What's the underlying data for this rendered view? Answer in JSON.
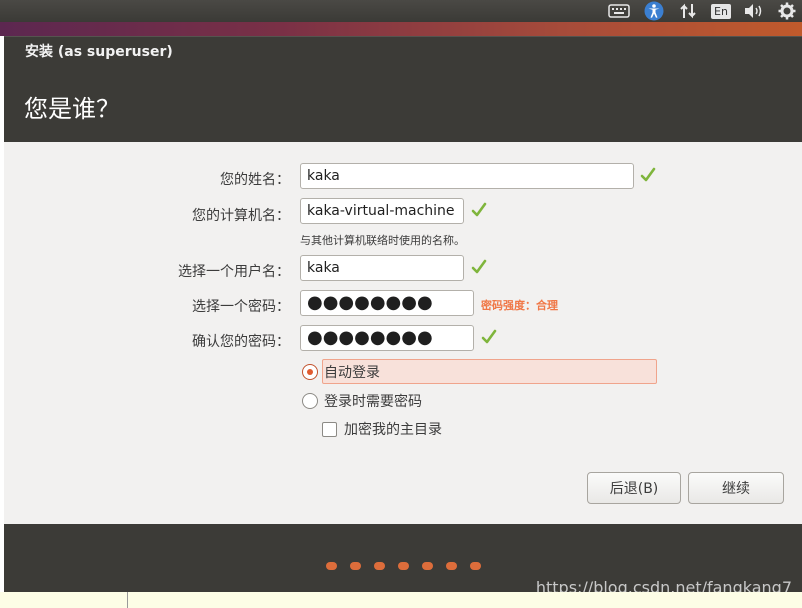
{
  "panel": {
    "indicators": [
      "keyboard-icon",
      "accessibility-icon",
      "network-icon",
      "language-icon",
      "volume-icon",
      "gear-icon"
    ],
    "language_label": "En"
  },
  "window": {
    "title": "安装 (as superuser)",
    "heading": "您是谁？"
  },
  "form": {
    "name_label": "您的姓名：",
    "name_value": "kaka",
    "computer_label": "您的计算机名：",
    "computer_value": "kaka-virtual-machine",
    "computer_hint": "与其他计算机联络时使用的名称。",
    "username_label": "选择一个用户名：",
    "username_value": "kaka",
    "password_label": "选择一个密码：",
    "password_value": "●●●●●●●●",
    "password_strength": "密码强度：合理",
    "confirm_label": "确认您的密码：",
    "confirm_value": "●●●●●●●●",
    "auto_login_label": "自动登录",
    "require_password_label": "登录时需要密码",
    "encrypt_home_label": "加密我的主目录",
    "selected_login_option": "自动登录"
  },
  "buttons": {
    "back_label": "后退(B)",
    "continue_label": "继续"
  },
  "progress": {
    "steps_total": 7
  },
  "watermark": "https://blog.csdn.net/fangkang7",
  "colors": {
    "accent": "#e05a2e",
    "check": "#7fb53c",
    "strength": "#f07746",
    "dark": "#3c3b37"
  }
}
